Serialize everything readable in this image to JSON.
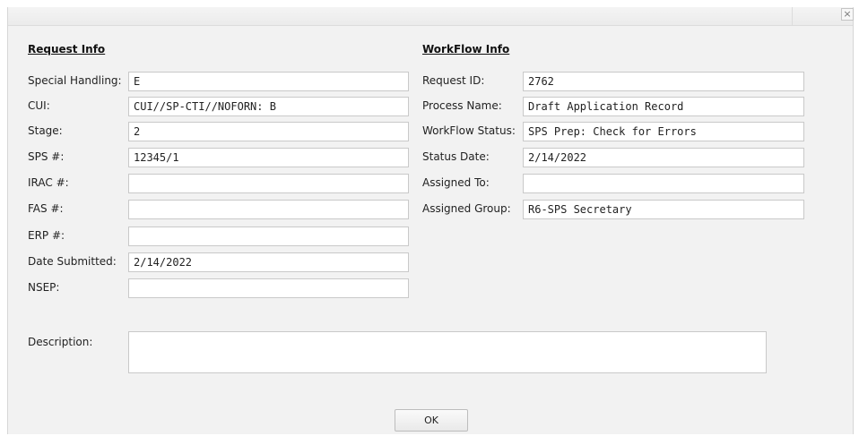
{
  "dialog": {
    "close_glyph": "×",
    "ok_label": "OK"
  },
  "request_info": {
    "heading": "Request Info",
    "fields": [
      {
        "label": "Special Handling:",
        "value": "E"
      },
      {
        "label": "CUI:",
        "value": "CUI//SP-CTI//NOFORN: B"
      },
      {
        "label": "Stage:",
        "value": "2"
      },
      {
        "label": "SPS #:",
        "value": "12345/1"
      },
      {
        "label": "IRAC #:",
        "value": ""
      },
      {
        "label": "FAS #:",
        "value": ""
      },
      {
        "label": "ERP #:",
        "value": ""
      },
      {
        "label": "Date Submitted:",
        "value": "2/14/2022"
      },
      {
        "label": "NSEP:",
        "value": ""
      }
    ]
  },
  "workflow_info": {
    "heading": "WorkFlow Info",
    "fields": [
      {
        "label": "Request ID:",
        "value": "2762"
      },
      {
        "label": "Process Name:",
        "value": "Draft Application Record"
      },
      {
        "label": "WorkFlow Status:",
        "value": "SPS Prep: Check for Errors"
      },
      {
        "label": "Status Date:",
        "value": "2/14/2022"
      },
      {
        "label": "Assigned To:",
        "value": ""
      },
      {
        "label": "Assigned Group:",
        "value": "R6-SPS Secretary"
      }
    ]
  },
  "description": {
    "label": "Description:",
    "value": ""
  }
}
